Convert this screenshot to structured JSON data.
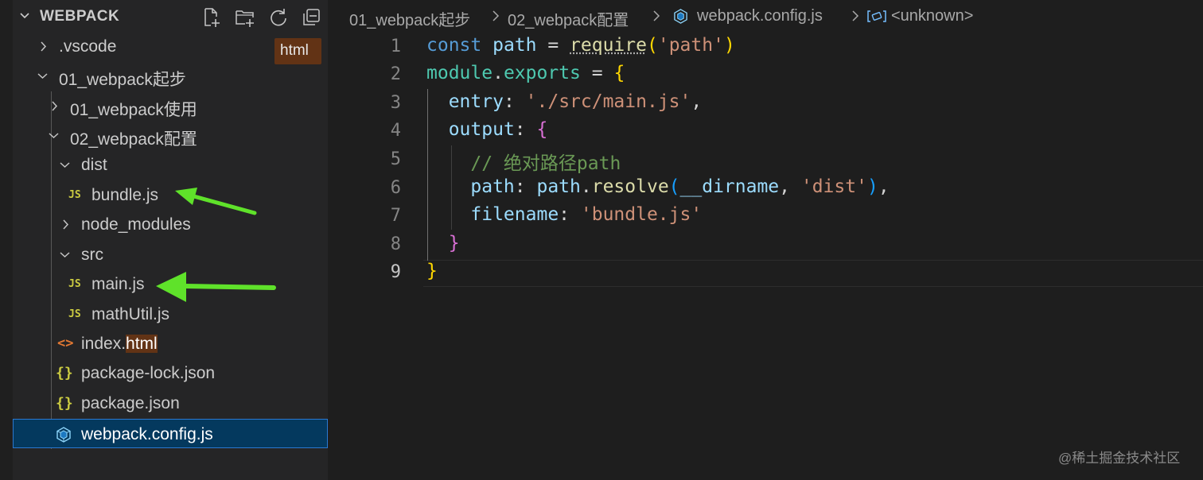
{
  "explorer": {
    "title": "WEBPACK",
    "actions": [
      "new-file-icon",
      "new-folder-icon",
      "refresh-icon",
      "collapse-all-icon"
    ],
    "tooltip": "html",
    "items": [
      {
        "label": ".vscode",
        "type": "folder",
        "expanded": false
      },
      {
        "label": "01_webpack起步",
        "type": "folder",
        "expanded": true
      },
      {
        "label": "01_webpack使用",
        "type": "folder",
        "expanded": false
      },
      {
        "label": "02_webpack配置",
        "type": "folder",
        "expanded": true
      },
      {
        "label": "dist",
        "type": "folder",
        "expanded": true
      },
      {
        "label": "bundle.js",
        "type": "js",
        "icon": "JS"
      },
      {
        "label": "node_modules",
        "type": "folder",
        "expanded": false
      },
      {
        "label": "src",
        "type": "folder",
        "expanded": true
      },
      {
        "label": "main.js",
        "type": "js",
        "icon": "JS"
      },
      {
        "label": "mathUtil.js",
        "type": "js",
        "icon": "JS"
      },
      {
        "label_prefix": "index.",
        "label_match": "html",
        "type": "html",
        "icon": "<>"
      },
      {
        "label": "package-lock.json",
        "type": "json",
        "icon": "{}"
      },
      {
        "label": "package.json",
        "type": "json",
        "icon": "{}"
      },
      {
        "label": "webpack.config.js",
        "type": "webpack",
        "selected": true
      }
    ]
  },
  "breadcrumb": {
    "items": [
      "01_webpack起步",
      "02_webpack配置",
      "webpack.config.js",
      "<unknown>"
    ]
  },
  "editor": {
    "line_numbers": [
      "1",
      "2",
      "3",
      "4",
      "5",
      "6",
      "7",
      "8",
      "9"
    ],
    "active_line": "9",
    "code": {
      "l1": {
        "kw": "const",
        "var": "path",
        "op": " = ",
        "fn": "require",
        "open": "(",
        "str": "'path'",
        "close": ")"
      },
      "l2": {
        "var1": "module",
        "dot": ".",
        "var2": "exports",
        "op": " = ",
        "brace": "{"
      },
      "l3": {
        "key": "entry",
        "colon": ": ",
        "str": "'./src/main.js'",
        "comma": ","
      },
      "l4": {
        "key": "output",
        "colon": ": ",
        "brace": "{"
      },
      "l5": {
        "comment": "// 绝对路径path"
      },
      "l6": {
        "key": "path",
        "colon": ": ",
        "obj": "path",
        "dot": ".",
        "fn": "resolve",
        "open": "(",
        "arg": "__dirname",
        "sep": ", ",
        "str": "'dist'",
        "close": ")",
        "comma": ","
      },
      "l7": {
        "key": "filename",
        "colon": ": ",
        "str": "'bundle.js'"
      },
      "l8": {
        "brace": "}"
      },
      "l9": {
        "brace": "}"
      }
    }
  },
  "watermark": "@稀土掘金技术社区",
  "colors": {
    "sidebar_bg": "#252526",
    "editor_bg": "#1e1e1e",
    "selection": "#04395e",
    "arrow": "#5fe22a",
    "js_icon": "#cbcb41",
    "html_icon": "#e37933",
    "webpack_icon": "#8ed6fb"
  }
}
